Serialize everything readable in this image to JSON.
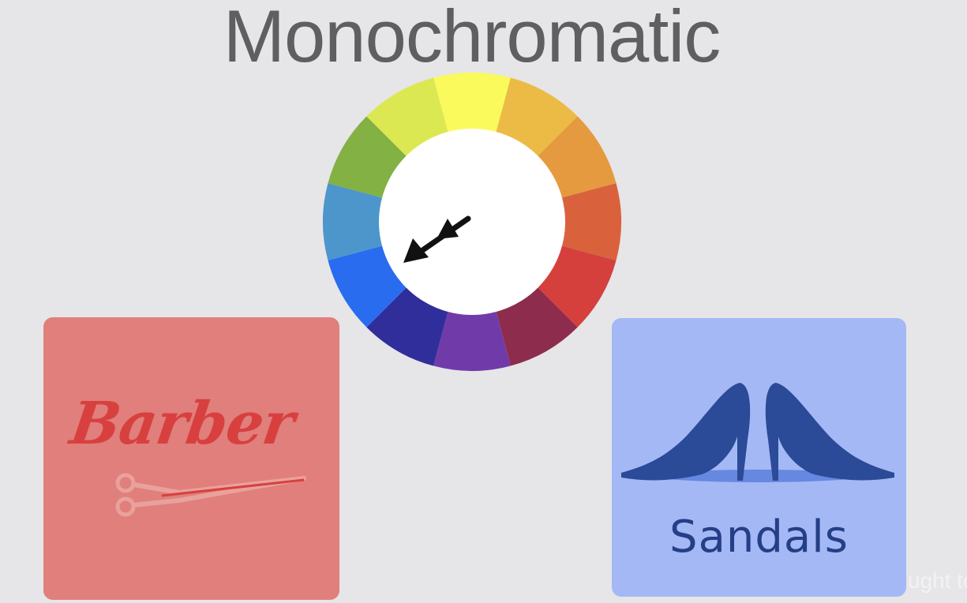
{
  "slide": {
    "title": "Monochromatic",
    "caption_fragment": "ught to"
  },
  "color_wheel": {
    "segments": [
      "#fafa5c",
      "#ecbb45",
      "#e59a3f",
      "#d9623d",
      "#d5403c",
      "#8e2c4e",
      "#703ba9",
      "#302e9b",
      "#2a6cf0",
      "#4c96cc",
      "#83b143",
      "#dce851"
    ],
    "center_color": "#ffffff",
    "pointer_icon": "arrow-pointing-down-left-icon"
  },
  "cards": {
    "barber": {
      "logo_text": "Barber",
      "background": "#e07f7b",
      "accent": "#d8403f",
      "icon": "scissors-icon"
    },
    "sandals": {
      "logo_text": "Sandals",
      "background": "#a4b8f5",
      "accent": "#243f85",
      "icon": "high-heel-shoes-icon"
    }
  }
}
